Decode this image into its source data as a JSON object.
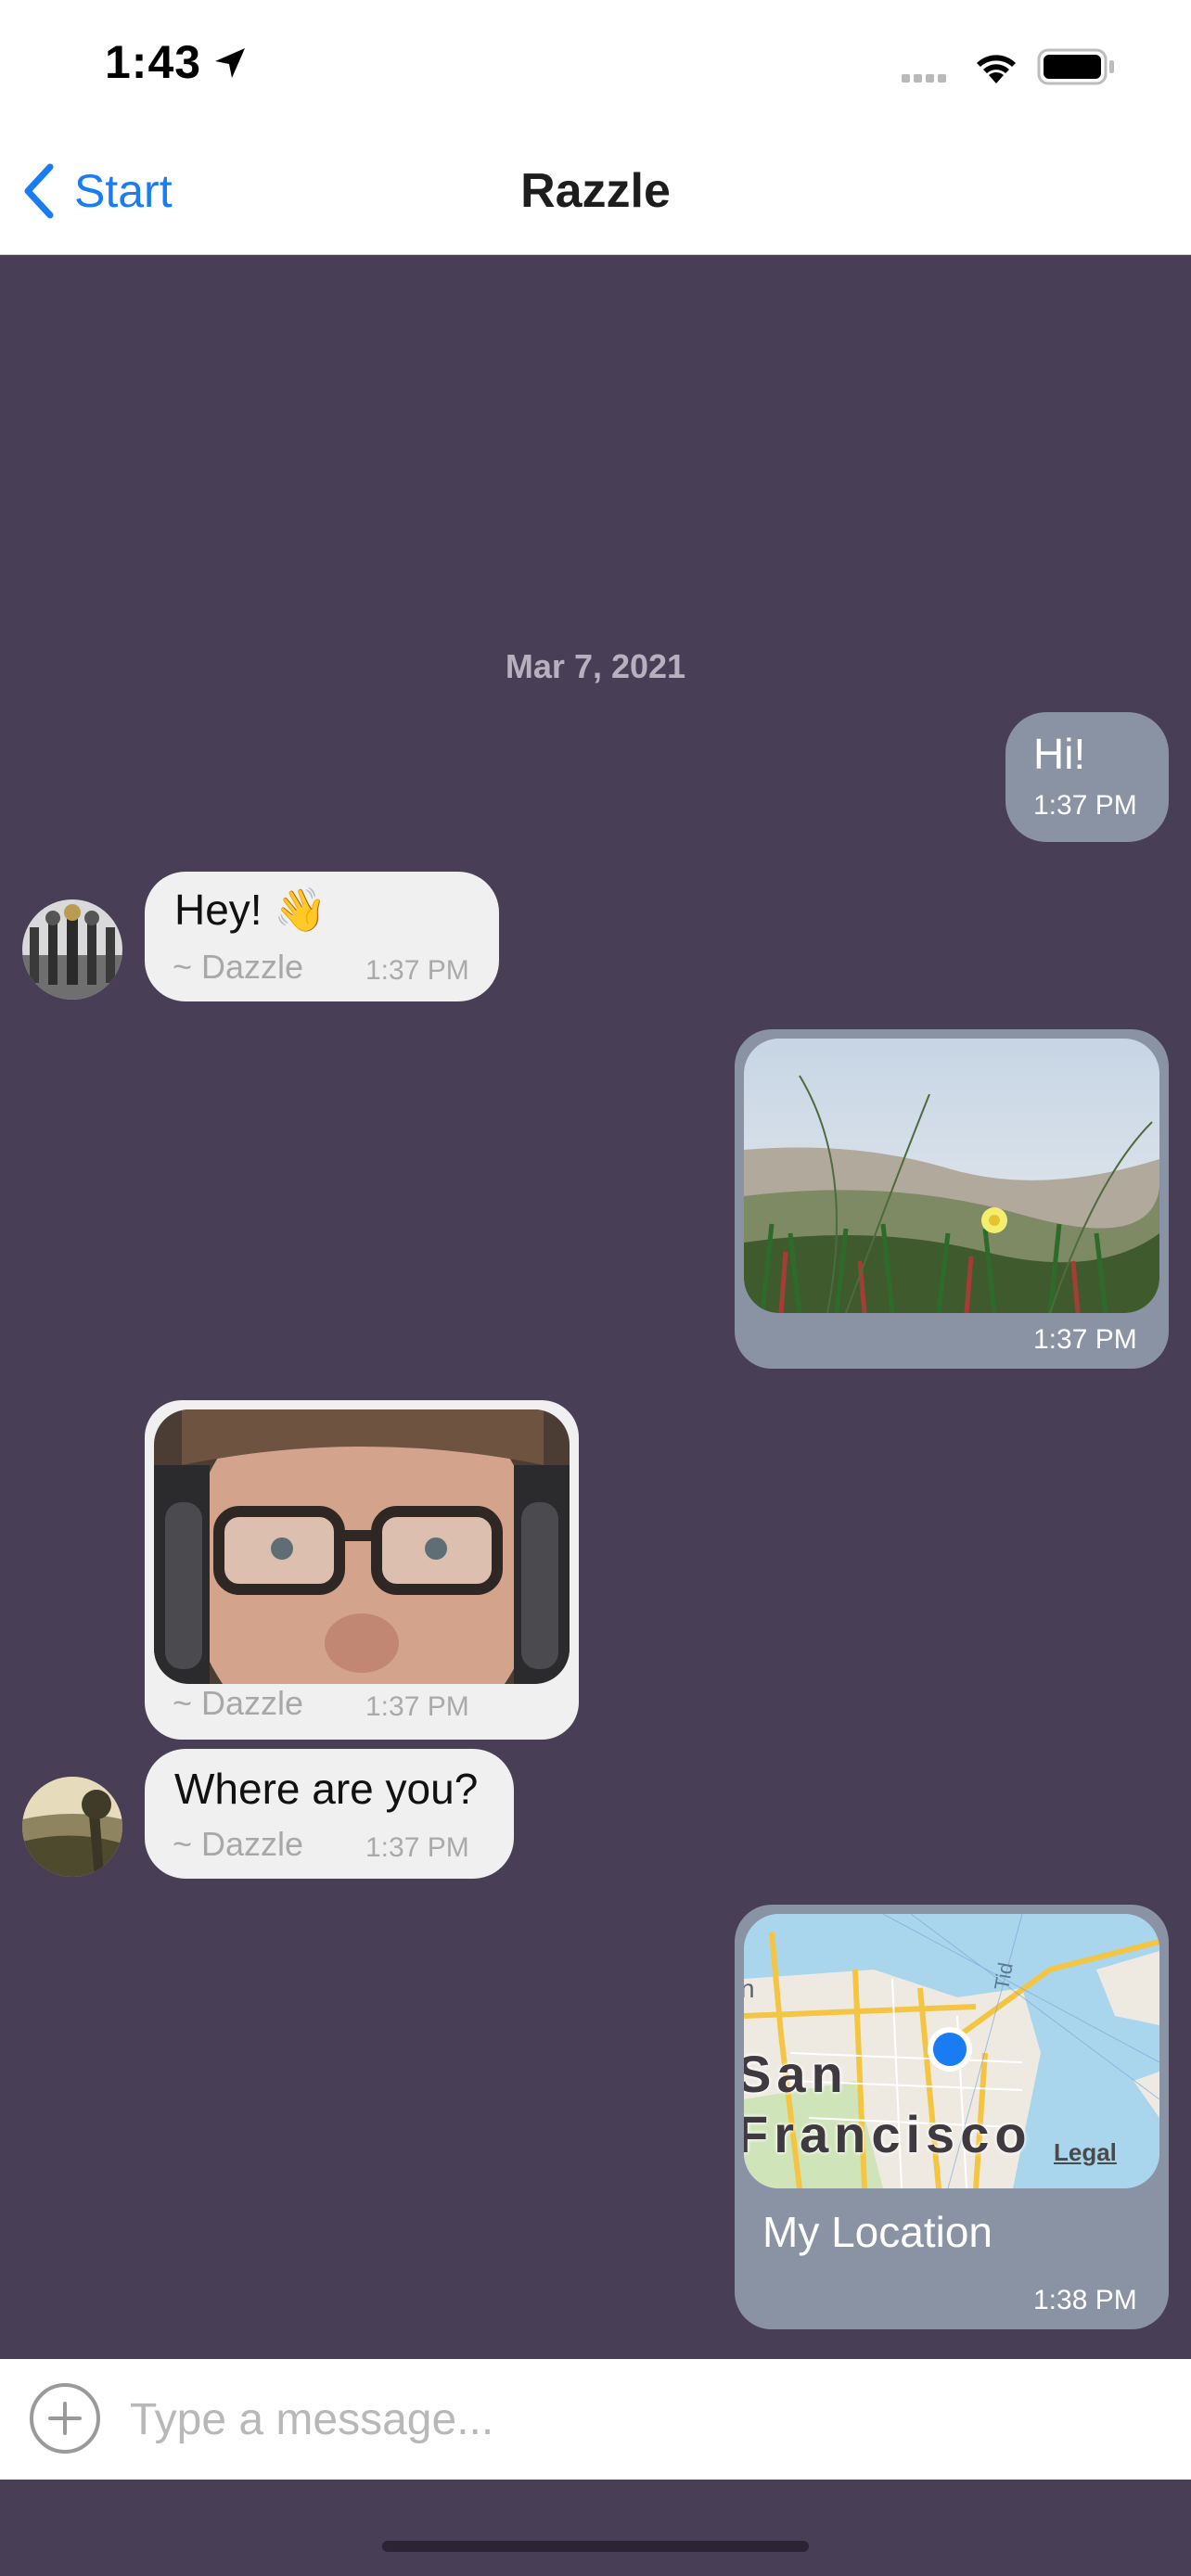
{
  "status_bar": {
    "time": "1:43"
  },
  "nav": {
    "back_label": "Start",
    "title": "Razzle"
  },
  "date_separator": "Mar 7, 2021",
  "messages": [
    {
      "text": "Hi!",
      "time": "1:37 PM"
    },
    {
      "text": "Hey! 👋",
      "sender": "~ Dazzle",
      "time": "1:37 PM"
    },
    {
      "time": "1:37 PM"
    },
    {
      "sender": "~ Dazzle",
      "time": "1:37 PM"
    },
    {
      "text": "Where are you?",
      "sender": "~ Dazzle",
      "time": "1:37 PM"
    },
    {
      "map_label": "San Francisco",
      "map_legal": "Legal",
      "text": "My Location",
      "time": "1:38 PM"
    }
  ],
  "input": {
    "placeholder": "Type a message..."
  },
  "colors": {
    "chat_background": "#483f56",
    "outgoing_bubble": "#8a93a3",
    "incoming_bubble": "#f0f0f0",
    "accent": "#1a7cf2"
  }
}
